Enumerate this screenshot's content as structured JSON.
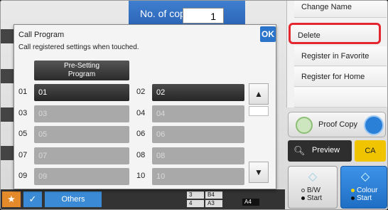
{
  "header": {
    "copies_label": "No. of copies",
    "copies_value": "1"
  },
  "right_panel": {
    "items": [
      {
        "label": "Change Name"
      },
      {
        "label": "Delete"
      },
      {
        "label": "Register in Favorite"
      },
      {
        "label": "Register for Home"
      },
      {
        "label": ""
      }
    ],
    "proof_copy": "Proof Copy",
    "preview": "Preview",
    "ca": "CA",
    "bw_start": [
      "B/W",
      "Start"
    ],
    "colour_start": [
      "Colour",
      "Start"
    ]
  },
  "dialog": {
    "title": "Call Program",
    "subtitle": "Call registered settings when touched.",
    "ok_label": "OK",
    "preset_label_1": "Pre-Setting",
    "preset_label_2": "Program",
    "programs": [
      {
        "num": "01",
        "label": "01",
        "active": true
      },
      {
        "num": "02",
        "label": "02",
        "active": true
      },
      {
        "num": "03",
        "label": "03",
        "active": false
      },
      {
        "num": "04",
        "label": "04",
        "active": false
      },
      {
        "num": "05",
        "label": "05",
        "active": false
      },
      {
        "num": "06",
        "label": "06",
        "active": false
      },
      {
        "num": "07",
        "label": "07",
        "active": false
      },
      {
        "num": "08",
        "label": "08",
        "active": false
      },
      {
        "num": "09",
        "label": "09",
        "active": false
      },
      {
        "num": "10",
        "label": "10",
        "active": false
      }
    ]
  },
  "bottom_bar": {
    "others_label": "Others",
    "tray": {
      "row1_num": "3",
      "row1_size": "B4",
      "row2_num": "4",
      "row2_size": "A3",
      "size_badge": "A4"
    }
  },
  "colors": {
    "accent_blue": "#2a74cc",
    "delete_highlight": "#e3262f",
    "ca_yellow": "#f0c400"
  }
}
